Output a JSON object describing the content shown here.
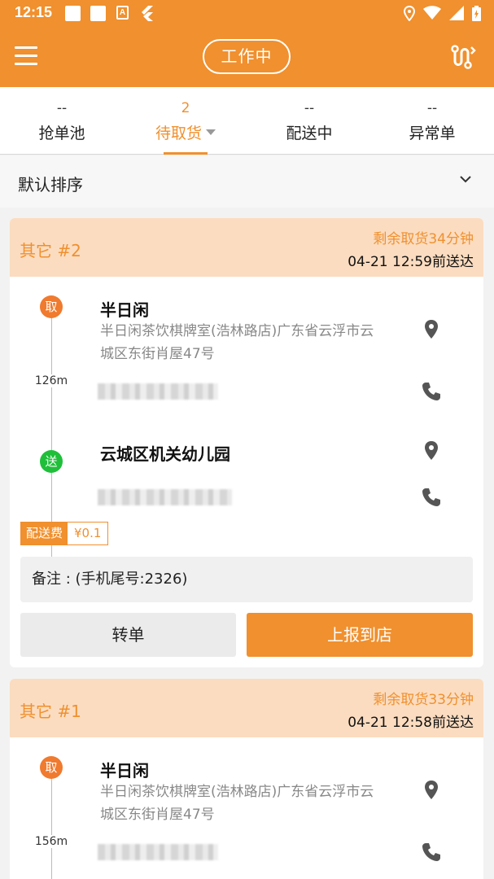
{
  "status_bar": {
    "time": "12:15"
  },
  "app_bar": {
    "status_label": "工作中",
    "accent_color": "#f0902e"
  },
  "tabs": [
    {
      "count": "--",
      "label": "抢单池",
      "active": false
    },
    {
      "count": "2",
      "label": "待取货",
      "active": true
    },
    {
      "count": "--",
      "label": "配送中",
      "active": false
    },
    {
      "count": "--",
      "label": "异常单",
      "active": false
    }
  ],
  "sort": {
    "label": "默认排序"
  },
  "orders": [
    {
      "tag": "其它 #2",
      "remaining": "剩余取货34分钟",
      "deadline": "04-21 12:59前送达",
      "pickup_badge": "取",
      "pickup_name": "半日闲",
      "pickup_address": "半日闲茶饮棋牌室(浩林路店)广东省云浮市云城区东街肖屋47号",
      "distance": "126m",
      "delivery_badge": "送",
      "delivery_name": "云城区机关幼儿园",
      "fee_label": "配送费",
      "fee_value": "¥0.1",
      "remark": "备注 : (手机尾号:2326)",
      "transfer_label": "转单",
      "report_label": "上报到店"
    },
    {
      "tag": "其它 #1",
      "remaining": "剩余取货33分钟",
      "deadline": "04-21 12:58前送达",
      "pickup_badge": "取",
      "pickup_name": "半日闲",
      "pickup_address": "半日闲茶饮棋牌室(浩林路店)广东省云浮市云城区东街肖屋47号",
      "distance": "156m"
    }
  ]
}
